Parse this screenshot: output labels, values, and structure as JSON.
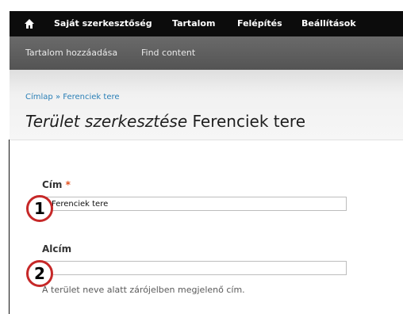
{
  "toolbar": {
    "items": [
      "Saját szerkesztőség",
      "Tartalom",
      "Felépítés",
      "Beállítások"
    ]
  },
  "shortcuts": {
    "items": [
      "Tartalom hozzáadása",
      "Find content"
    ]
  },
  "breadcrumb": {
    "home": "Címlap",
    "separator": "»",
    "current": "Ferenciek tere"
  },
  "page_title": {
    "prefix": "Terület szerkesztése",
    "name": "Ferenciek tere"
  },
  "form": {
    "title_field": {
      "label": "Cím",
      "required_marker": "*",
      "value": "Ferenciek tere"
    },
    "subtitle_field": {
      "label": "Alcím",
      "value": "",
      "description": "A terület neve alatt zárójelben megjelenő cím."
    }
  },
  "annotations": {
    "marker_1": "1",
    "marker_2": "2",
    "color": "#c62828"
  }
}
